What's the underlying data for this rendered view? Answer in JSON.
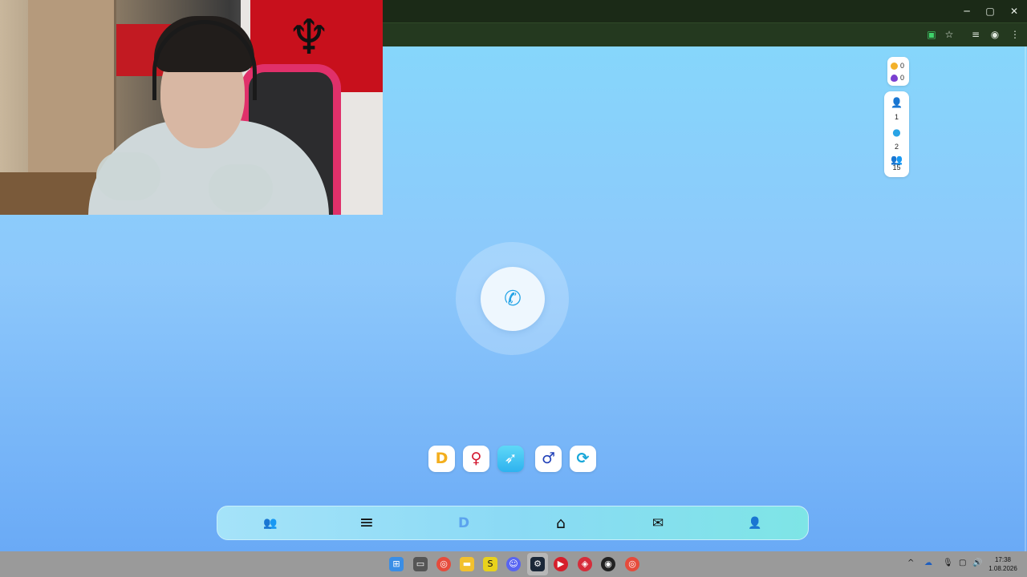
{
  "window_controls": {
    "minimize": "─",
    "maximize": "▢",
    "close": "✕"
  },
  "toolbar": {
    "extension_icon": "extension-icon",
    "bookmark_icon": "star-icon",
    "media_icon": "queue-icon",
    "profile_icon": "avatar",
    "menu_icon": "⋮"
  },
  "currency": {
    "coins": "0",
    "gems": "0",
    "coin_color": "#f3b12b",
    "gem_color": "#7a3fd0"
  },
  "stats": {
    "friends": "1",
    "time": "2",
    "group": "15"
  },
  "call": {
    "icon": "phone-icon",
    "glyph": "✆"
  },
  "filters": [
    {
      "name": "brand-filter",
      "glyph": "D",
      "color": "#f3ae1d"
    },
    {
      "name": "female-filter",
      "glyph": "♀",
      "color": "#d3172e"
    },
    {
      "name": "rocket-filter",
      "glyph": "➶",
      "color": "#ffffff"
    },
    {
      "name": "male-filter",
      "glyph": "♂",
      "color": "#1f3fb8"
    },
    {
      "name": "refresh-filter",
      "glyph": "⟳",
      "color": "#19a7d9"
    }
  ],
  "nav": {
    "friends": "👥",
    "menu": "≡",
    "logo": "D",
    "home": "⌂",
    "messages": "✉",
    "profile": "👤"
  },
  "accent_color": "#29a4e6",
  "taskbar": {
    "clock_time": "17:38",
    "clock_date": "1.08.2026"
  }
}
